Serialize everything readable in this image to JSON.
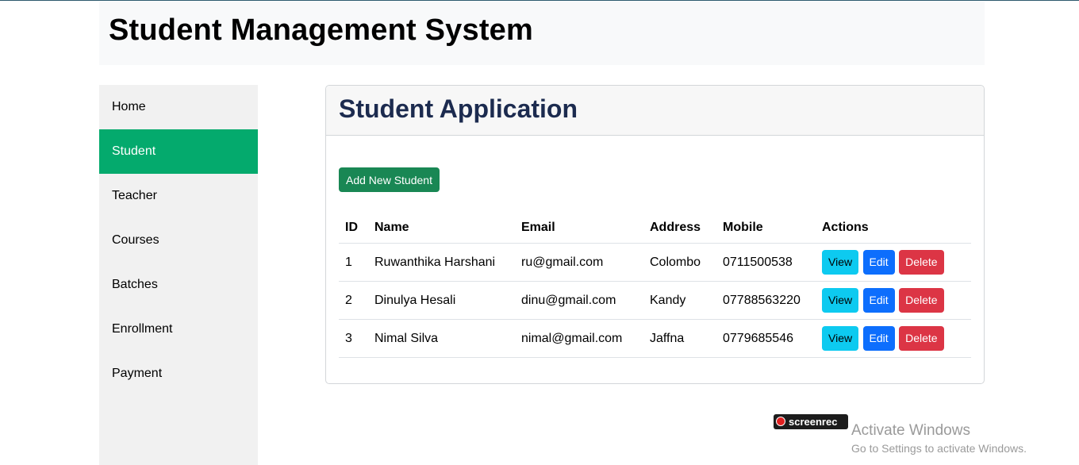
{
  "app": {
    "title": "Student Management System"
  },
  "sidebar": {
    "items": [
      {
        "label": "Home"
      },
      {
        "label": "Student"
      },
      {
        "label": "Teacher"
      },
      {
        "label": "Courses"
      },
      {
        "label": "Batches"
      },
      {
        "label": "Enrollment"
      },
      {
        "label": "Payment"
      }
    ],
    "active": "Student"
  },
  "main": {
    "title": "Student Application",
    "add_button": "Add New Student",
    "table": {
      "headers": [
        "ID",
        "Name",
        "Email",
        "Address",
        "Mobile",
        "Actions"
      ],
      "rows": [
        {
          "id": "1",
          "name": "Ruwanthika Harshani",
          "email": "ru@gmail.com",
          "address": "Colombo",
          "mobile": "0711500538"
        },
        {
          "id": "2",
          "name": "Dinulya Hesali",
          "email": "dinu@gmail.com",
          "address": "Kandy",
          "mobile": "07788563220"
        },
        {
          "id": "3",
          "name": "Nimal Silva",
          "email": "nimal@gmail.com",
          "address": "Jaffna",
          "mobile": "0779685546"
        }
      ],
      "actions": {
        "view": "View",
        "edit": "Edit",
        "delete": "Delete"
      }
    }
  },
  "overlay": {
    "screenrec": "screenrec",
    "activate_title": "Activate Windows",
    "activate_subtitle": "Go to Settings to activate Windows."
  },
  "colors": {
    "active_sidebar": "#04aa6d",
    "add_button": "#198754",
    "view_button": "#0dcaf0",
    "edit_button": "#0d6efd",
    "delete_button": "#dc3545"
  }
}
